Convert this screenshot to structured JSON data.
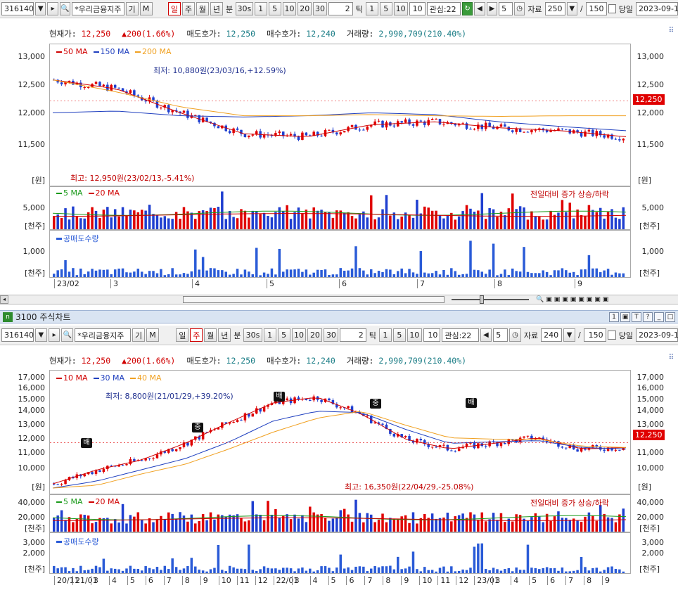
{
  "toolbar1": {
    "code": "316140",
    "stock": "*우리금융지주",
    "periods": [
      "일",
      "주",
      "월",
      "년"
    ],
    "selected_period": "일",
    "min_label": "분",
    "sec_label": "30s",
    "ticks_a": [
      "1",
      "5",
      "10",
      "20",
      "30"
    ],
    "tick_count": "2",
    "tick_label": "틱",
    "ticks_b": [
      "1",
      "5",
      "10"
    ],
    "tick_value": "10",
    "interest": "관심:22",
    "count": "5",
    "data_label": "자료",
    "data_count": "250",
    "total": "150",
    "same_day": "당일",
    "date": "2023-09-1"
  },
  "toolbar2": {
    "code": "316140",
    "stock": "*우리금융지주",
    "periods": [
      "일",
      "주",
      "월",
      "년"
    ],
    "selected_period": "주",
    "min_label": "분",
    "sec_label": "30s",
    "ticks_a": [
      "1",
      "5",
      "10",
      "20",
      "30"
    ],
    "tick_count": "2",
    "tick_label": "틱",
    "ticks_b": [
      "1",
      "5",
      "10"
    ],
    "tick_value": "10",
    "interest": "관심:22",
    "count": "5",
    "data_label": "자료",
    "data_count": "240",
    "total": "150",
    "same_day": "당일",
    "date": "2023-09-1"
  },
  "window_title": "3100 주식차트",
  "quote": {
    "price_label": "현재가:",
    "price": "12,250",
    "change": "200(1.66%)",
    "ask_label": "매도호가:",
    "ask": "12,250",
    "bid_label": "매수호가:",
    "bid": "12,240",
    "volume_label": "거래량:",
    "volume": "2,990,709(210.40%)"
  },
  "panel1": {
    "legend": [
      {
        "name": "50 MA",
        "color": "#d00000"
      },
      {
        "name": "150 MA",
        "color": "#1f3fbf"
      },
      {
        "name": "200 MA",
        "color": "#f0a020"
      }
    ],
    "price_ticks": [
      "13,000",
      "12,500",
      "12,000",
      "11,500"
    ],
    "unit": "[원]",
    "current_tag": "12,250",
    "low_note": "최저: 10,880원(23/03/16,+12.59%)",
    "high_note": "최고: 12,950원(23/02/13,-5.41%)",
    "vol_legend": [
      {
        "name": "5 MA",
        "color": "#1a9a1a"
      },
      {
        "name": "20 MA",
        "color": "#d00000"
      }
    ],
    "vol_note": "전일대비 증가 상승/하락",
    "vol_ticks": [
      "5,000"
    ],
    "vol_unit": "[천주]",
    "short_legend": "공매도수량",
    "short_ticks": [
      "1,000"
    ],
    "short_unit": "[천주]",
    "x_labels": [
      "23/02",
      "3",
      "4",
      "5",
      "6",
      "7",
      "8",
      "9"
    ]
  },
  "panel2": {
    "legend": [
      {
        "name": "10 MA",
        "color": "#d00000"
      },
      {
        "name": "30 MA",
        "color": "#1f3fbf"
      },
      {
        "name": "40 MA",
        "color": "#f0a020"
      }
    ],
    "price_ticks": [
      "17,000",
      "16,000",
      "15,000",
      "14,000",
      "13,000",
      "12,000",
      "11,000",
      "10,000"
    ],
    "unit": "[원]",
    "current_tag": "12,250",
    "low_note": "최저: 8,800원(21/01/29,+39.20%)",
    "high_note": "최고: 16,350원(22/04/29,-25.08%)",
    "markers": [
      "배",
      "중",
      "배",
      "중",
      "배"
    ],
    "vol_legend": [
      {
        "name": "5 MA",
        "color": "#1a9a1a"
      },
      {
        "name": "20 MA",
        "color": "#d00000"
      }
    ],
    "vol_note": "전일대비 증가 상승/하락",
    "vol_ticks": [
      "40,000",
      "20,000"
    ],
    "vol_unit": "[천주]",
    "short_legend": "공매도수량",
    "short_ticks": [
      "3,000",
      "2,000"
    ],
    "short_unit": "[천주]",
    "x_labels": [
      "20/11",
      "21/01",
      "3",
      "4",
      "5",
      "6",
      "7",
      "8",
      "9",
      "10",
      "11",
      "12",
      "22/01",
      "3",
      "4",
      "5",
      "6",
      "7",
      "8",
      "9",
      "10",
      "11",
      "12",
      "23/01",
      "3",
      "4",
      "5",
      "6",
      "7",
      "8",
      "9"
    ]
  },
  "chart_data": [
    {
      "type": "line",
      "series": [
        {
          "name": "50 MA",
          "values": [
            12600,
            12450,
            12050,
            11700,
            11650,
            11850,
            11900,
            11800,
            11750,
            11650
          ]
        },
        {
          "name": "150 MA",
          "values": [
            12050,
            12080,
            12000,
            11980,
            12000,
            12050,
            12020,
            11900,
            11820,
            11750
          ]
        },
        {
          "name": "200 MA",
          "values": [
            12600,
            12400,
            12150,
            12000,
            12000,
            12020,
            12000,
            11990,
            12000,
            12000
          ]
        }
      ],
      "categories": [
        "23/02",
        "3",
        "4",
        "5",
        "6",
        "7",
        "8",
        "9"
      ],
      "ylim": [
        10880,
        13100
      ],
      "price_current": 12250
    },
    {
      "type": "line",
      "series": [
        {
          "name": "10 MA",
          "values": [
            9300,
            10300,
            11000,
            12200,
            13700,
            15100,
            15500,
            14300,
            12500,
            11800,
            12200,
            12600,
            11800,
            11900
          ]
        },
        {
          "name": "30 MA",
          "values": [
            9000,
            9500,
            10300,
            11100,
            12300,
            13800,
            14500,
            14400,
            13200,
            12200,
            12300,
            12400,
            11900,
            11800
          ]
        },
        {
          "name": "40 MA",
          "values": [
            9000,
            9200,
            10000,
            10700,
            11800,
            13000,
            14000,
            14500,
            13500,
            12600,
            12500,
            12500,
            12000,
            11900
          ]
        }
      ],
      "categories": [
        "20/11",
        "21/01",
        "3",
        "4",
        "5",
        "6",
        "7",
        "8",
        "9",
        "10",
        "11",
        "12",
        "22/01",
        "3",
        "4",
        "5",
        "6",
        "7",
        "8",
        "9",
        "10",
        "11",
        "12",
        "23/01",
        "3",
        "4",
        "5",
        "6",
        "7",
        "8",
        "9"
      ],
      "ylim": [
        8800,
        17000
      ],
      "price_current": 12250
    }
  ]
}
